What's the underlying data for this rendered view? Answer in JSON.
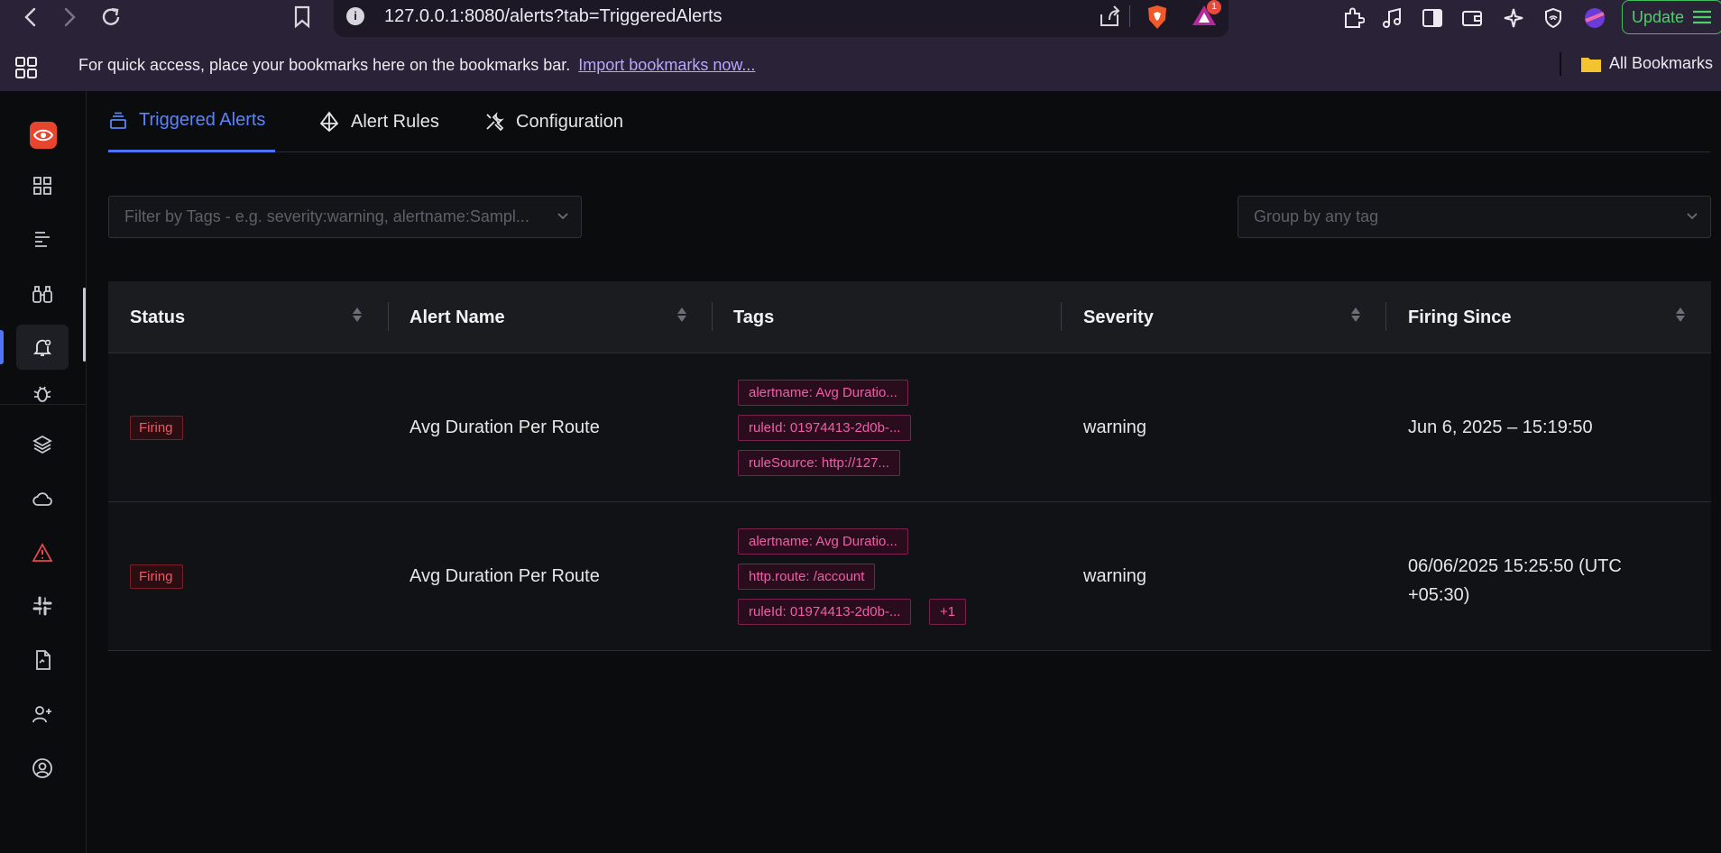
{
  "browser": {
    "url": "127.0.0.1:8080/alerts?tab=TriggeredAlerts",
    "notification_count": "1",
    "update_label": "Update"
  },
  "bookmarks_bar": {
    "message": "For quick access, place your bookmarks here on the bookmarks bar.",
    "import_link": "Import bookmarks now...",
    "all_bookmarks": "All Bookmarks"
  },
  "tabs": [
    {
      "label": "Triggered Alerts",
      "icon": "stack-icon",
      "active": true
    },
    {
      "label": "Alert Rules",
      "icon": "diamond-icon",
      "active": false
    },
    {
      "label": "Configuration",
      "icon": "tools-icon",
      "active": false
    }
  ],
  "filter": {
    "placeholder": "Filter by Tags - e.g. severity:warning, alertname:Sampl...",
    "group_placeholder": "Group by any tag"
  },
  "table": {
    "columns": [
      "Status",
      "Alert Name",
      "Tags",
      "Severity",
      "Firing Since"
    ],
    "rows": [
      {
        "status": "Firing",
        "name": "Avg Duration Per Route",
        "tags": [
          "alertname: Avg Duratio...",
          "ruleId: 01974413-2d0b-...",
          "ruleSource: http://127..."
        ],
        "severity": "warning",
        "firing_since_line1": "Jun 6, 2025 – 15:19:50",
        "firing_since_line2": ""
      },
      {
        "status": "Firing",
        "name": "Avg Duration Per Route",
        "tags": [
          "alertname: Avg Duratio...",
          "http.route: /account",
          "ruleId: 01974413-2d0b-...",
          "+1"
        ],
        "severity": "warning",
        "firing_since_line1": "06/06/2025 15:25:50 (UTC",
        "firing_since_line2": "+05:30)"
      }
    ]
  },
  "colors": {
    "accent": "#4e74f8",
    "firing": "#f25767",
    "tag": "#f05ea9"
  }
}
